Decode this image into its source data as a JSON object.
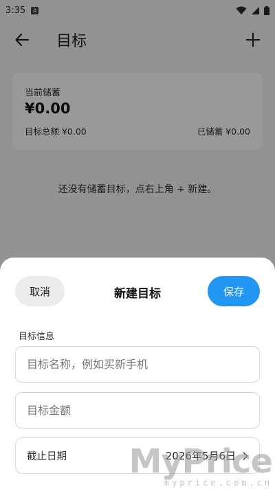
{
  "status_bar": {
    "time": "3:35",
    "app_badge": "A"
  },
  "app_bar": {
    "title": "目标"
  },
  "summary": {
    "current_label": "当前储蓄",
    "current_value": "¥0.00",
    "total_label": "目标总额 ¥0.00",
    "saved_label": "已储蓄 ¥0.00"
  },
  "empty_hint": "还没有储蓄目标，点右上角 + 新建。",
  "sheet": {
    "cancel_label": "取消",
    "title": "新建目标",
    "save_label": "保存",
    "section_label": "目标信息",
    "name_placeholder": "目标名称，例如买新手机",
    "name_value": "",
    "amount_placeholder": "目标金额",
    "amount_value": "",
    "deadline_label": "截止日期",
    "deadline_value": "2026年5月6日"
  },
  "watermark": {
    "brand": "MyPrice",
    "url": "myprice.com.cn"
  },
  "colors": {
    "accent": "#2196f3",
    "scrim": "rgba(0,0,0,0.40)"
  },
  "icons": [
    "back-arrow-icon",
    "plus-icon",
    "wifi-icon",
    "signal-icon",
    "battery-icon",
    "chevron-right-icon"
  ]
}
